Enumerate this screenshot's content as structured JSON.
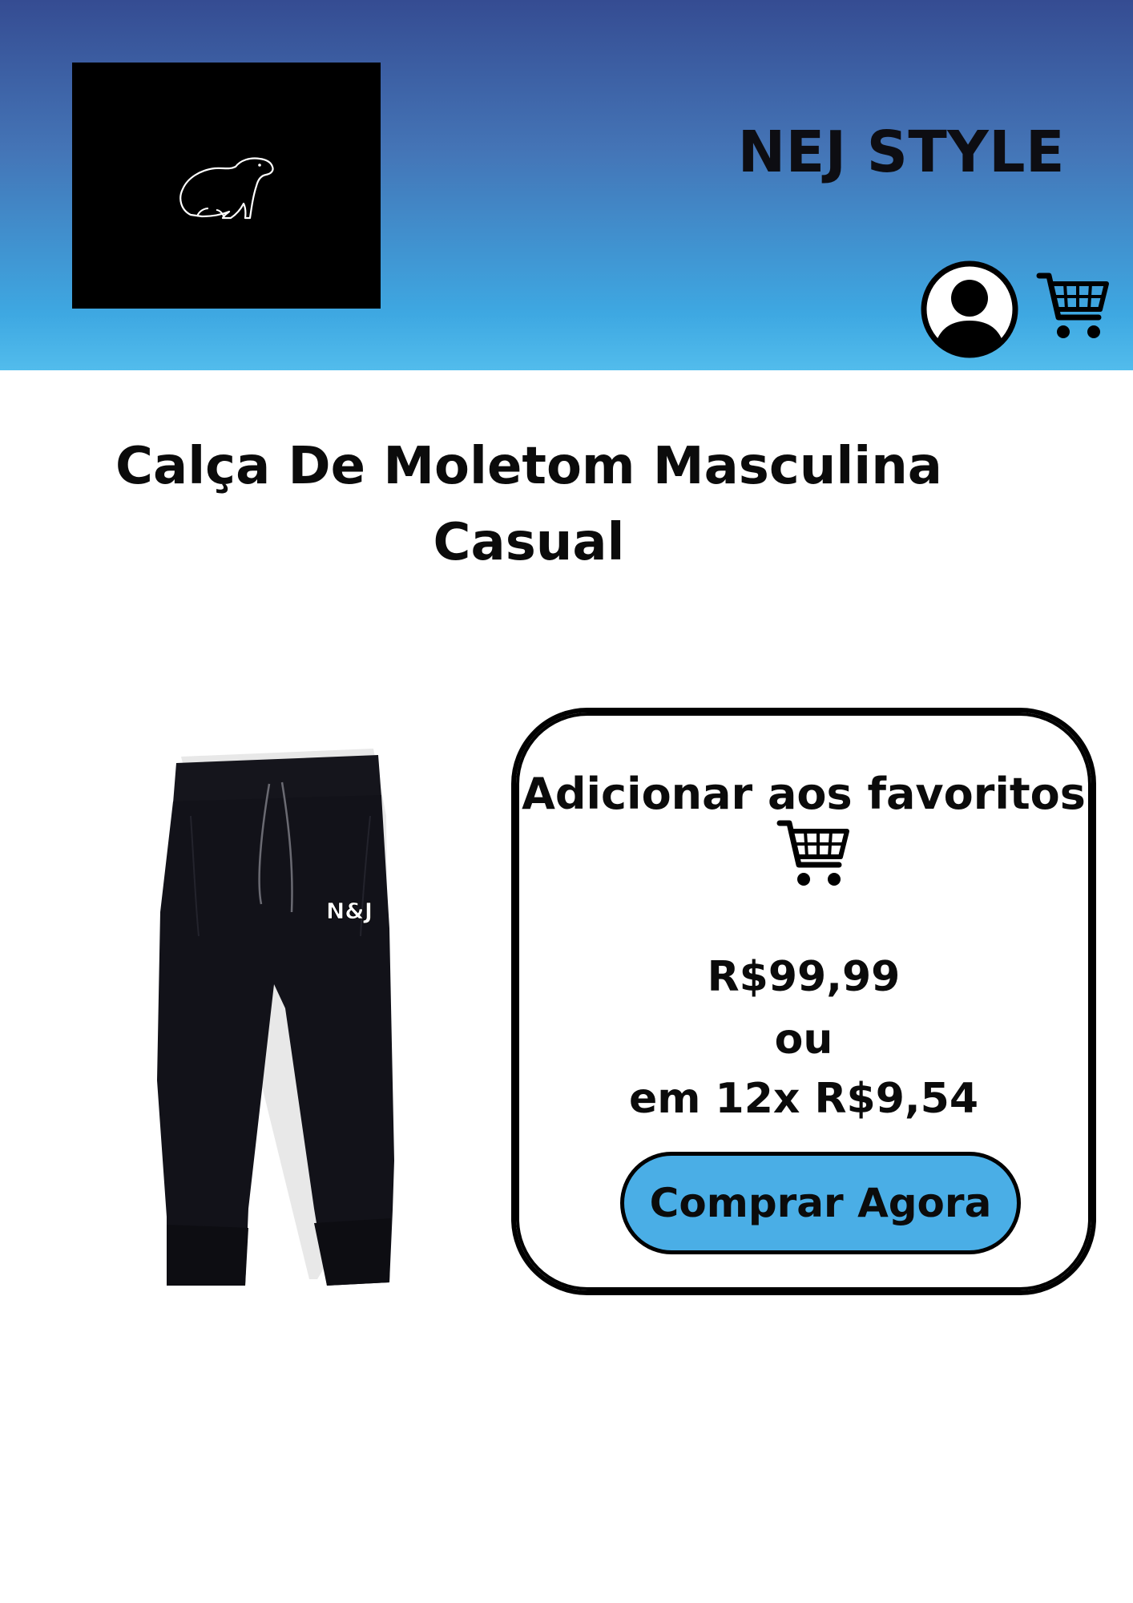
{
  "header": {
    "brand": "NEJ STYLE",
    "logo_icon": "capybara-outline",
    "profile_icon": "user-icon",
    "cart_icon": "cart-icon"
  },
  "product": {
    "title_line1": "Calça De Moletom Masculina",
    "title_line2": "Casual",
    "image_badge": "N&J"
  },
  "purchase_card": {
    "favorites_label": "Adicionar aos favoritos",
    "favorites_icon": "cart-icon",
    "price": "R$99,99",
    "or_label": "ou",
    "installments": "em 12x R$9,54",
    "buy_button_label": "Comprar Agora"
  },
  "colors": {
    "header_gradient_top": "#354c92",
    "header_gradient_bottom": "#52bcec",
    "button": "#4aaee6"
  }
}
